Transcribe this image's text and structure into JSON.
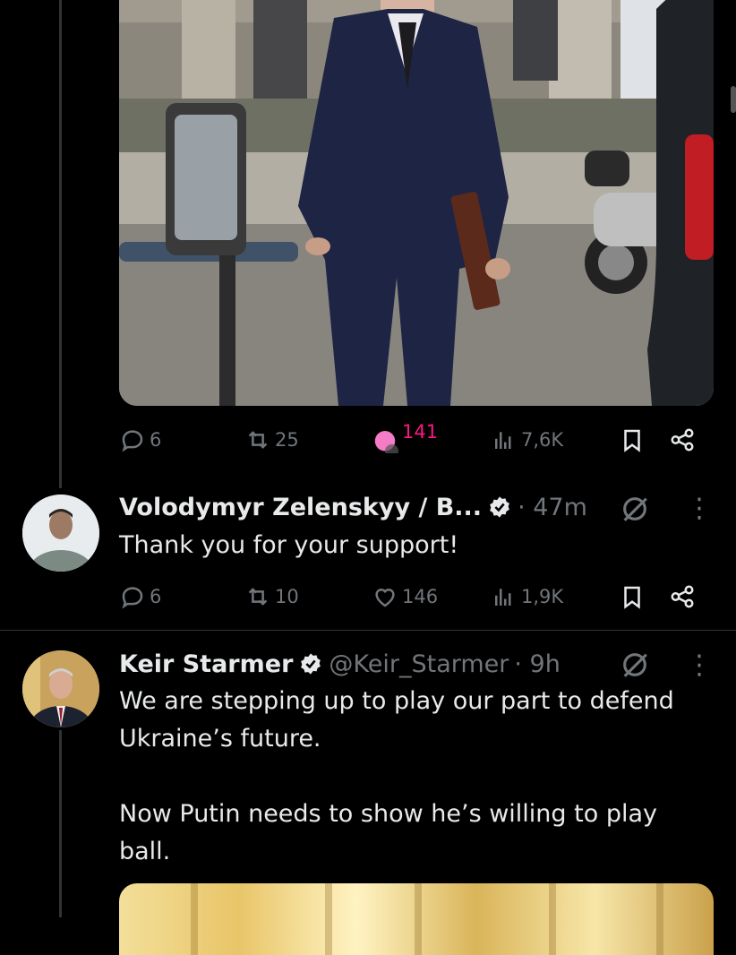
{
  "post1": {
    "actions": {
      "replies": "6",
      "reposts": "25",
      "likes": "141",
      "views": "7,6K"
    },
    "liked": true,
    "like_color": "#f91880"
  },
  "reply1": {
    "author_name": "Volodymyr Zelenskyy / B...",
    "time": "· 47m",
    "verified": true,
    "text": "Thank you for your support!",
    "actions": {
      "replies": "6",
      "reposts": "10",
      "likes": "146",
      "views": "1,9K"
    }
  },
  "post2": {
    "author_name": "Keir Starmer",
    "handle": "@Keir_Starmer",
    "time": "· 9h",
    "verified": true,
    "text": "We are stepping up to play our part to defend Ukraine’s future.\n\nNow Putin needs to show he’s willing to play ball."
  },
  "icons": {
    "reply": "comment-icon",
    "repost": "repost-icon",
    "like": "heart-icon",
    "views": "views-icon",
    "bookmark": "bookmark-icon",
    "share": "share-icon",
    "grok": "grok-icon",
    "more": "more-icon",
    "verified": "verified-badge-icon"
  },
  "colors": {
    "background": "#000000",
    "text": "#e7e9ea",
    "muted": "#71767b",
    "like": "#f91880",
    "verified": "#1d9bf0"
  }
}
